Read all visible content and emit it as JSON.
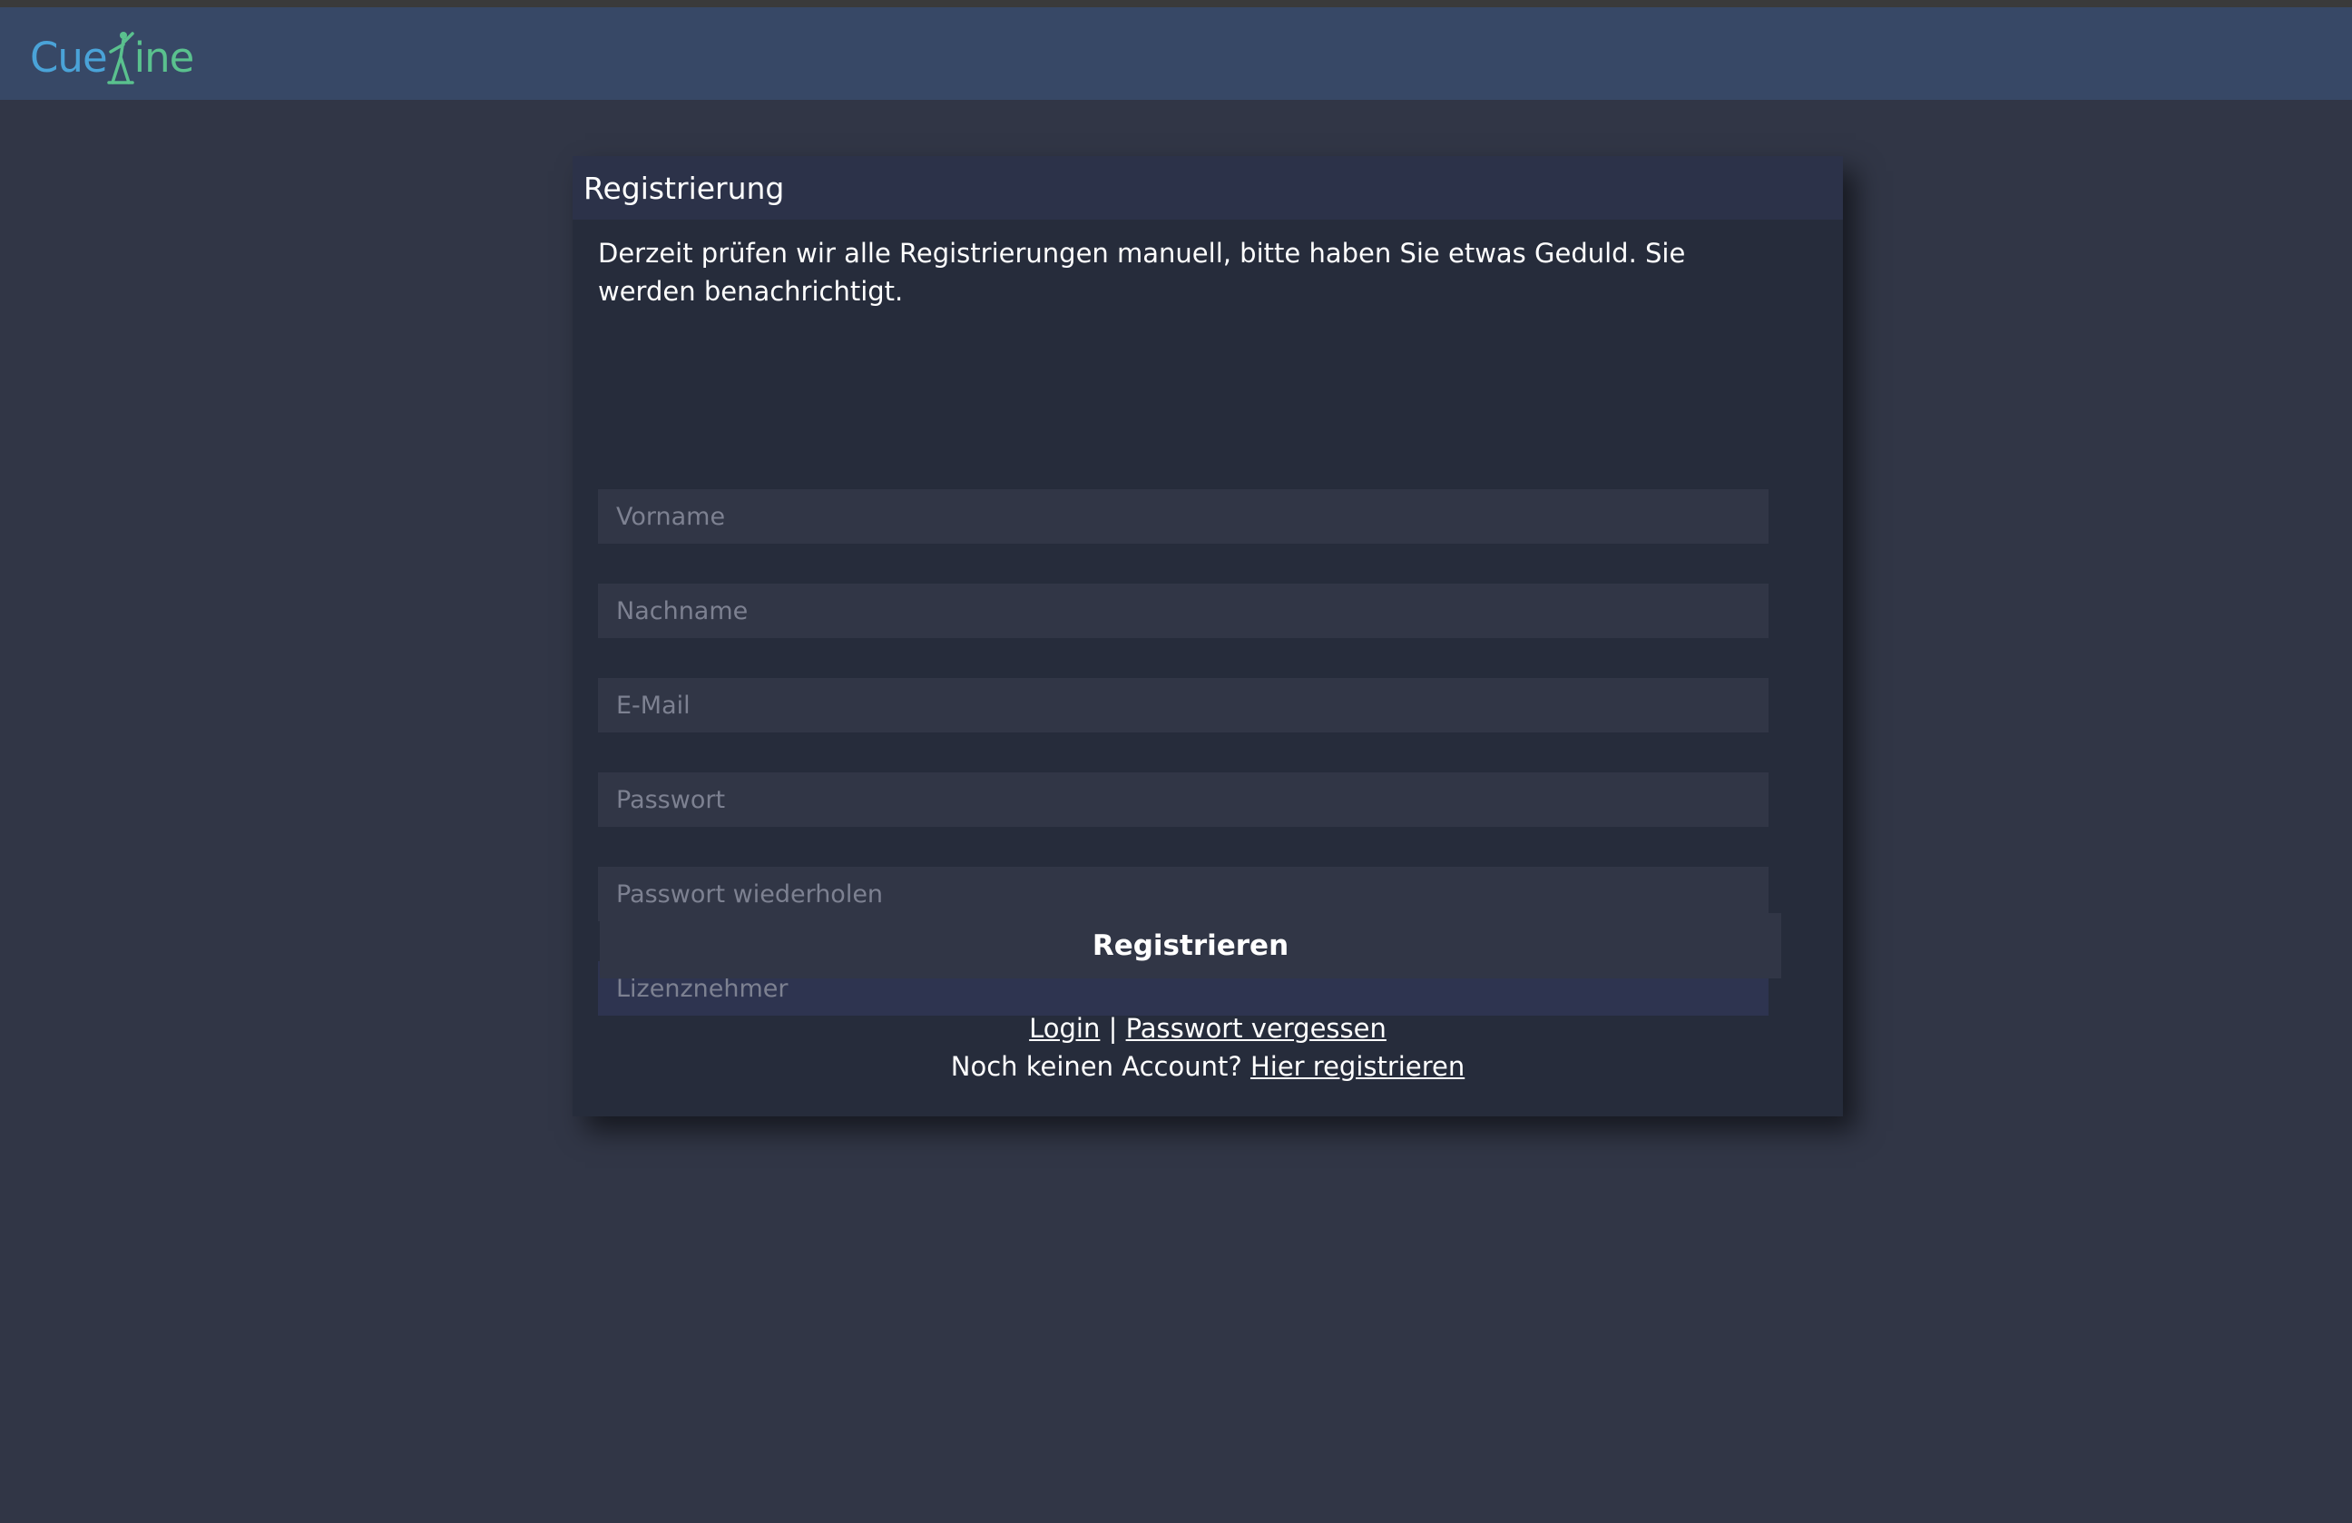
{
  "header": {
    "logo_text_part1": "Cue",
    "logo_text_part2": "ine",
    "logo_figure_icon": "person-figure-icon"
  },
  "form": {
    "title": "Registrierung",
    "notice": "Derzeit prüfen wir alle Registrierungen manuell, bitte haben Sie etwas Geduld. Sie werden benachrichtigt.",
    "fields": {
      "vorname_placeholder": "Vorname",
      "nachname_placeholder": "Nachname",
      "email_placeholder": "E-Mail",
      "passwort_placeholder": "Passwort",
      "passwort_repeat_placeholder": "Passwort wiederholen",
      "lizenznehmer_placeholder": "Lizenznehmer"
    },
    "submit_label": "Registrieren",
    "links": {
      "login": "Login",
      "separator": "|",
      "forgot_password": "Passwort vergessen",
      "no_account_text": "Noch keinen Account?",
      "register_here": "Hier registrieren"
    }
  },
  "colors": {
    "background": "#313646",
    "header": "#374866",
    "card": "#262c3b",
    "card_header": "#2c3249",
    "logo_blue": "#4aa3d8",
    "logo_green": "#5ac18e"
  }
}
